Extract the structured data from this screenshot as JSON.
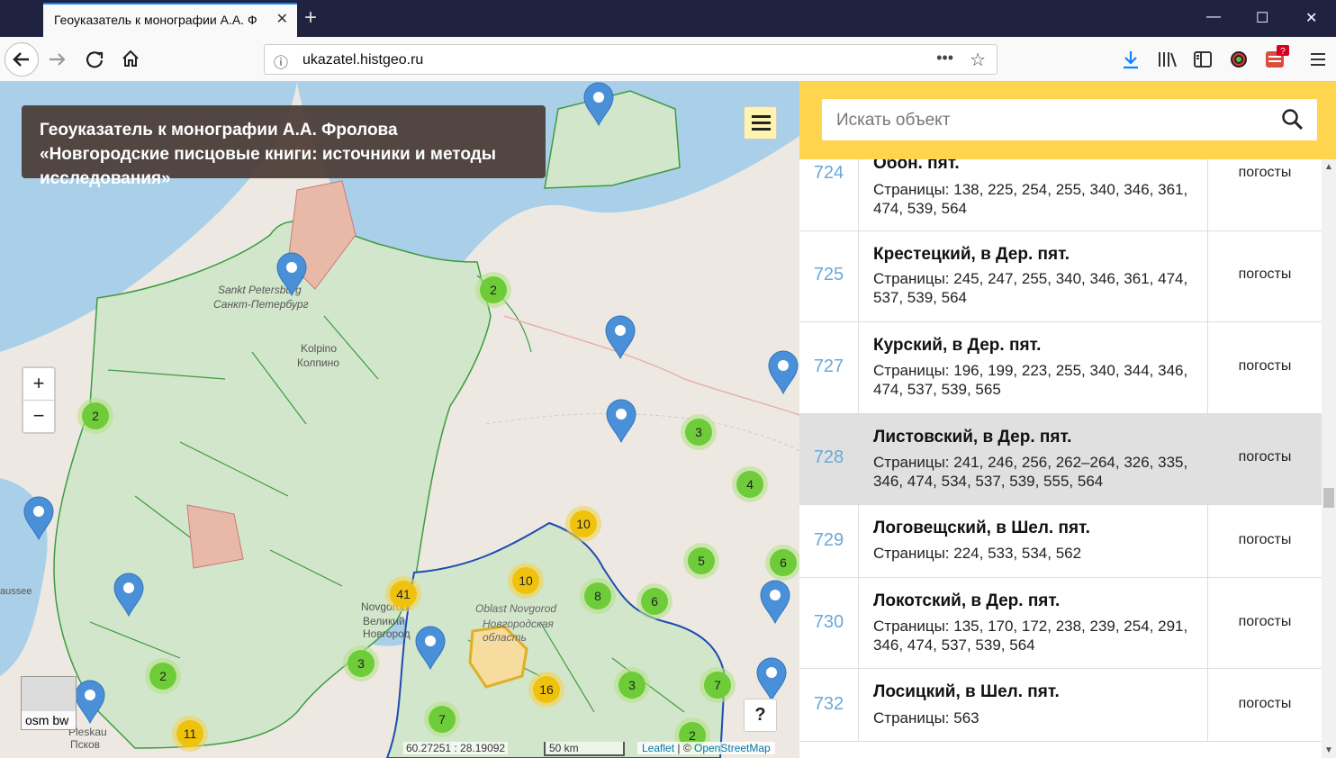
{
  "browser": {
    "tab_title": "Геоуказатель к монографии А.А. Ф",
    "url": "ukazatel.histgeo.ru"
  },
  "map": {
    "title": "Геоуказатель к монографии А.А. Фролова «Новгородские писцовые книги: источники и методы исследования»",
    "labels": {
      "spb1": "Sankt Petersburg",
      "spb2": "Санкт-Петербург",
      "kolpino1": "Kolpino",
      "kolpino2": "Колпино",
      "novgorod1": "Novgorod",
      "novgorod2": "Великий Новгород",
      "oblast1": "Oblast Novgorod",
      "oblast2": "Новгородская область",
      "pskov1": "Pleskau",
      "pskov2": "Псков",
      "chaussee": "aussee"
    },
    "zoom_in": "+",
    "zoom_out": "−",
    "layer_label": "osm bw",
    "help": "?",
    "coords": "60.27251 : 28.19092",
    "scale": "50 km",
    "attribution_leaflet": "Leaflet",
    "attribution_sep": " | © ",
    "attribution_osm": "OpenStreetMap",
    "clusters": [
      {
        "label": "2",
        "color": "green"
      },
      {
        "label": "2",
        "color": "green"
      },
      {
        "label": "3",
        "color": "green"
      },
      {
        "label": "4",
        "color": "green"
      },
      {
        "label": "10",
        "color": "yellow"
      },
      {
        "label": "5",
        "color": "green"
      },
      {
        "label": "6",
        "color": "green"
      },
      {
        "label": "10",
        "color": "yellow"
      },
      {
        "label": "8",
        "color": "green"
      },
      {
        "label": "6",
        "color": "green"
      },
      {
        "label": "41",
        "color": "yellow"
      },
      {
        "label": "3",
        "color": "green"
      },
      {
        "label": "2",
        "color": "green"
      },
      {
        "label": "16",
        "color": "yellow"
      },
      {
        "label": "3",
        "color": "green"
      },
      {
        "label": "7",
        "color": "green"
      },
      {
        "label": "7",
        "color": "green"
      },
      {
        "label": "11",
        "color": "yellow"
      },
      {
        "label": "2",
        "color": "green"
      }
    ]
  },
  "search": {
    "placeholder": "Искать объект"
  },
  "rows": [
    {
      "num": "724",
      "name": "Обон. пят.",
      "pages": "Страницы: 138, 225, 254, 255, 340, 346, 361, 474, 539, 564",
      "cat": "погосты"
    },
    {
      "num": "725",
      "name": "Крестецкий, в Дер. пят.",
      "pages": "Страницы: 245, 247, 255, 340, 346, 361, 474, 537, 539, 564",
      "cat": "погосты"
    },
    {
      "num": "727",
      "name": "Курский, в Дер. пят.",
      "pages": "Страницы: 196, 199, 223, 255, 340, 344, 346, 474, 537, 539, 565",
      "cat": "погосты"
    },
    {
      "num": "728",
      "name": "Листовский, в Дер. пят.",
      "pages": "Страницы: 241, 246, 256, 262–264, 326, 335, 346, 474, 534, 537, 539, 555, 564",
      "cat": "погосты"
    },
    {
      "num": "729",
      "name": "Логовещский, в Шел. пят.",
      "pages": "Страницы: 224, 533, 534, 562",
      "cat": "погосты"
    },
    {
      "num": "730",
      "name": "Локотский, в Дер. пят.",
      "pages": "Страницы: 135, 170, 172, 238, 239, 254, 291, 346, 474, 537, 539, 564",
      "cat": "погосты"
    },
    {
      "num": "732",
      "name": "Лосицкий, в Шел. пят.",
      "pages": "Страницы: 563",
      "cat": "погосты"
    }
  ]
}
